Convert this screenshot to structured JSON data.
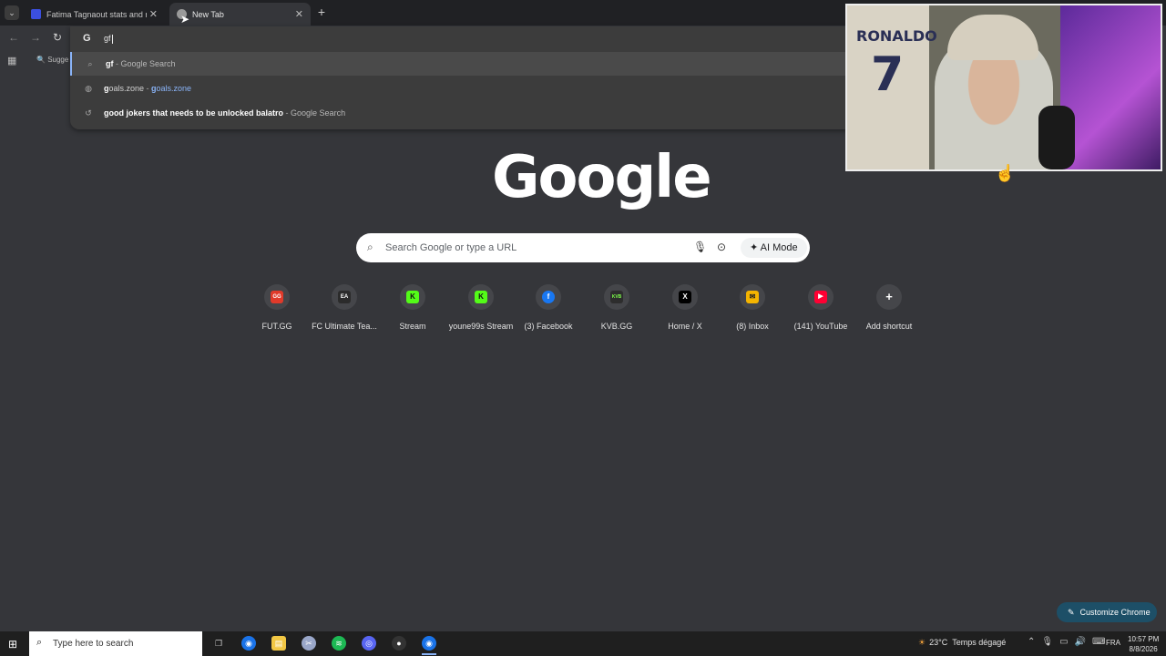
{
  "tabs": [
    {
      "title": "Fatima Tagnaout stats and ratin",
      "fav_color": "#3b4fe0",
      "active": false
    },
    {
      "title": "New Tab",
      "fav_color": "#9a9a9a",
      "active": true
    }
  ],
  "omnibox": {
    "typed": "gf",
    "suggestions": [
      {
        "icon": "search",
        "bold": "gf",
        "sep": " - ",
        "rest": "Google Search",
        "rest_kind": "muted"
      },
      {
        "icon": "globe",
        "bold": "g",
        "plain": "oals.zone",
        "sep": " - ",
        "url_bold": "g",
        "url_rest": "oals.zone"
      },
      {
        "icon": "history",
        "bold": "g",
        "plain": "ood jokers that needs to be unlocked balatro",
        "sep": " - ",
        "rest": "Google Search"
      }
    ]
  },
  "bookmarks": {
    "suggestion_label": "Sugge"
  },
  "logo": "Google",
  "search": {
    "placeholder": "Search Google or type a URL",
    "ai_mode": "AI Mode"
  },
  "shortcuts": [
    {
      "label": "FUT.GG",
      "icon_text": "GG",
      "color": "#e03a2a"
    },
    {
      "label": "FC Ultimate Tea...",
      "icon_text": "EA",
      "color": "#2b2b2b"
    },
    {
      "label": "Stream",
      "icon_text": "K",
      "color": "#53fc18"
    },
    {
      "label": "youne99s Stream",
      "icon_text": "K",
      "color": "#53fc18"
    },
    {
      "label": "(3) Facebook",
      "icon_text": "f",
      "color": "#1877f2"
    },
    {
      "label": "KVB.GG",
      "icon_text": "KVB",
      "color": "#2d2d2d"
    },
    {
      "label": "Home / X",
      "icon_text": "X",
      "color": "#000000"
    },
    {
      "label": "(8) Inbox",
      "icon_text": "✉",
      "color": "#f4b400"
    },
    {
      "label": "(141) YouTube",
      "icon_text": "▶",
      "color": "#ff0033"
    },
    {
      "label": "Add shortcut",
      "icon_text": "+",
      "color": "#45464a"
    }
  ],
  "webcam": {
    "jersey_name": "RONALDO",
    "jersey_number": "7"
  },
  "customize": {
    "label": "Customize Chrome"
  },
  "taskbar": {
    "search_placeholder": "Type here to search",
    "weather_temp": "23°C",
    "weather_desc": "Temps dégagé",
    "language": "FRA",
    "time": "10:57 PM",
    "date": "8/8/2026"
  }
}
